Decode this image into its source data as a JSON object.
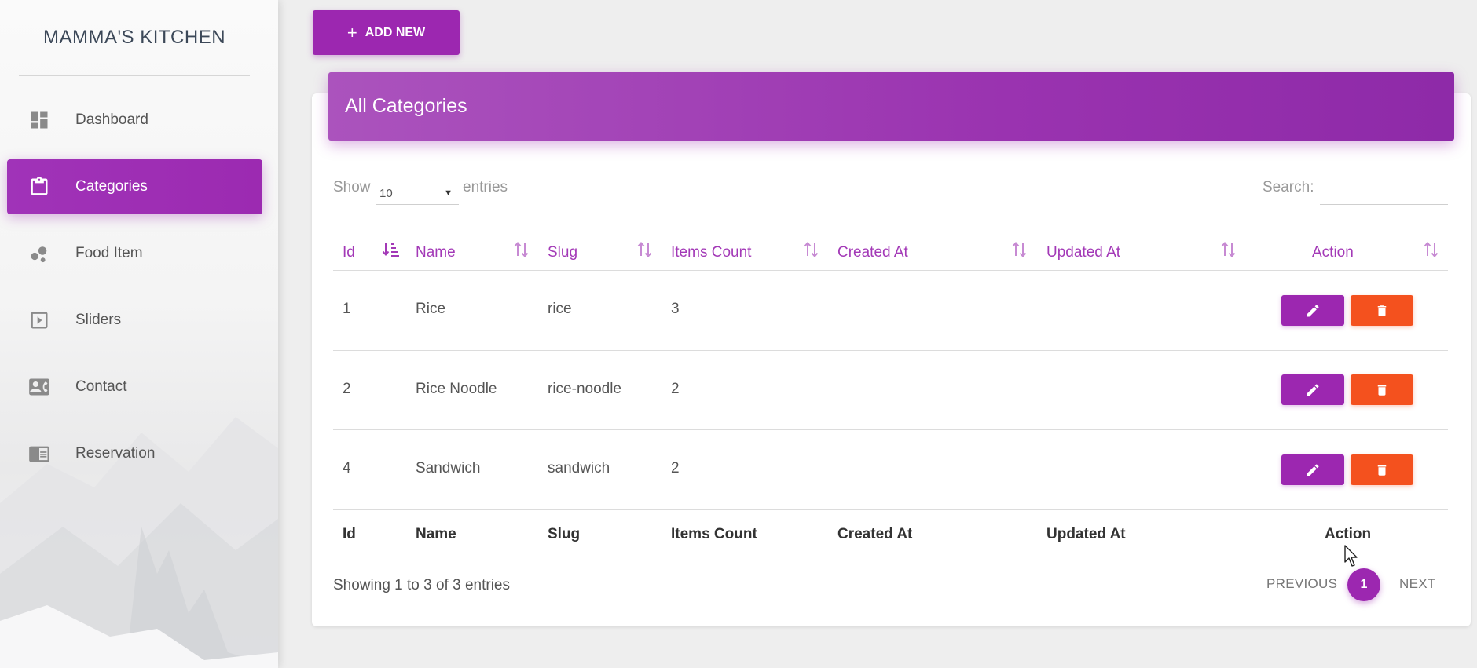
{
  "brand": "MAMMA'S KITCHEN",
  "sidebar": {
    "items": [
      {
        "label": "Dashboard",
        "icon": "dashboard-icon"
      },
      {
        "label": "Categories",
        "icon": "clipboard-icon",
        "active": true
      },
      {
        "label": "Food Item",
        "icon": "bubbles-icon"
      },
      {
        "label": "Sliders",
        "icon": "slideshow-icon"
      },
      {
        "label": "Contact",
        "icon": "contact-card-icon"
      },
      {
        "label": "Reservation",
        "icon": "chrome-reader-icon"
      }
    ]
  },
  "toolbar": {
    "add_plus": "+",
    "add_label": "ADD NEW"
  },
  "card": {
    "title": "All Categories"
  },
  "length_menu": {
    "show": "Show",
    "value": "10",
    "entries": "entries"
  },
  "search": {
    "label": "Search:",
    "value": ""
  },
  "table": {
    "columns": [
      "Id",
      "Name",
      "Slug",
      "Items Count",
      "Created At",
      "Updated At",
      "Action"
    ],
    "rows": [
      {
        "id": "1",
        "name": "Rice",
        "slug": "rice",
        "items_count": "3",
        "created_at": "",
        "updated_at": ""
      },
      {
        "id": "2",
        "name": "Rice Noodle",
        "slug": "rice-noodle",
        "items_count": "2",
        "created_at": "",
        "updated_at": ""
      },
      {
        "id": "4",
        "name": "Sandwich",
        "slug": "sandwich",
        "items_count": "2",
        "created_at": "",
        "updated_at": ""
      }
    ],
    "footer": [
      "Id",
      "Name",
      "Slug",
      "Items Count",
      "Created At",
      "Updated At",
      "Action"
    ]
  },
  "info": "Showing 1 to 3 of 3 entries",
  "pagination": {
    "previous": "PREVIOUS",
    "current": "1",
    "next": "NEXT"
  },
  "colors": {
    "primary": "#9c27b0",
    "danger": "#f4511e",
    "header_text": "#a339b7"
  }
}
